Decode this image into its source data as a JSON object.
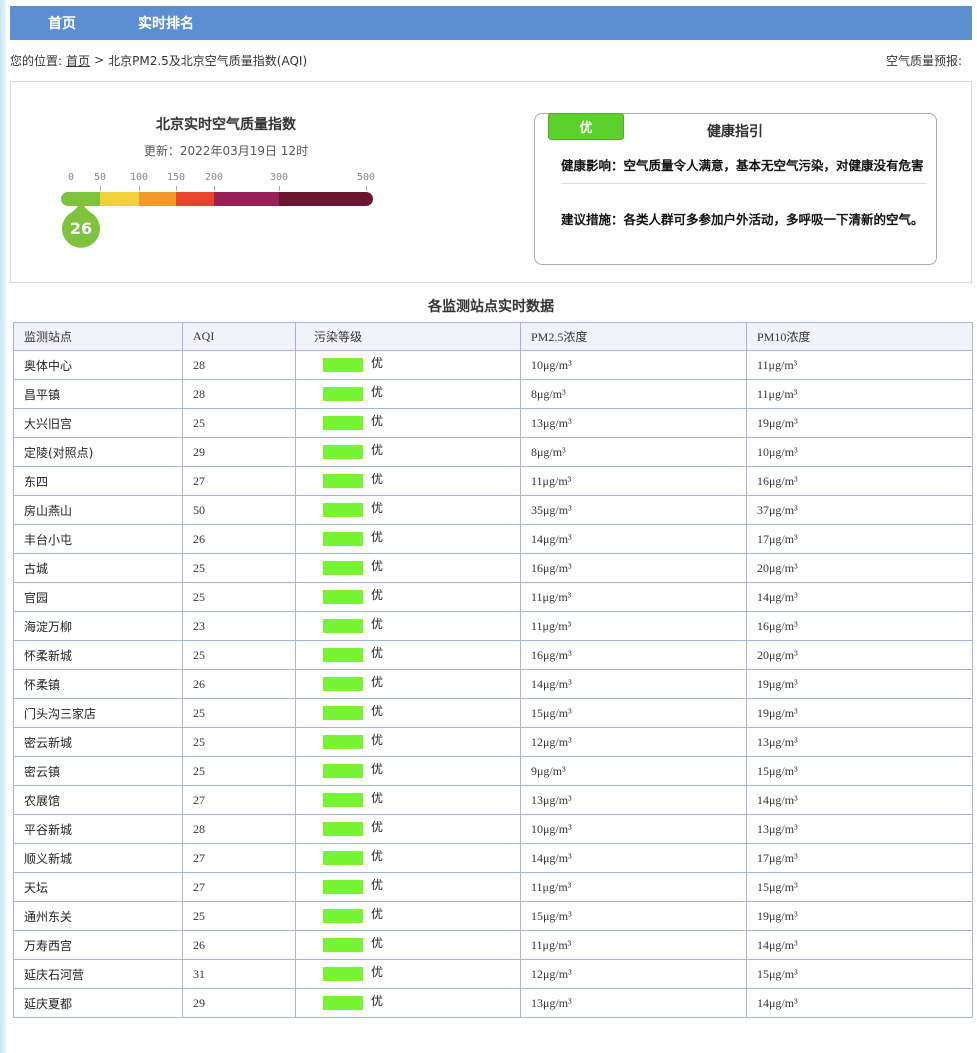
{
  "nav": {
    "home": "首页",
    "ranking": "实时排名"
  },
  "breadcrumb": {
    "prefix": "您的位置:",
    "home_link": "首页",
    "separator": ">",
    "current": "北京PM2.5及北京空气质量指数(AQI)",
    "forecast": "空气质量预报:"
  },
  "aqi": {
    "title": "北京实时空气质量指数",
    "update": "更新：2022年03月19日 12时",
    "value": "26",
    "scale_ticks": [
      "0",
      "50",
      "100",
      "150",
      "200",
      "300",
      "500"
    ],
    "scale_colors": [
      "#7dc33b",
      "#f2d23c",
      "#f09a2b",
      "#e8442b",
      "#962157",
      "#6b1630"
    ]
  },
  "health": {
    "level": "优",
    "title": "健康指引",
    "impact": "健康影响：空气质量令人满意，基本无空气污染，对健康没有危害",
    "advice": "建议措施：各类人群可多参加户外活动，多呼吸一下清新的空气。",
    "level_color": "#5bd12c"
  },
  "table": {
    "title": "各监测站点实时数据",
    "headers": [
      "监测站点",
      "AQI",
      "污染等级",
      "PM2.5浓度",
      "PM10浓度"
    ],
    "level_color": "#76f331",
    "rows": [
      {
        "station": "奥体中心",
        "aqi": "28",
        "level": "优",
        "pm25": "10μg/m³",
        "pm10": "11μg/m³"
      },
      {
        "station": "昌平镇",
        "aqi": "28",
        "level": "优",
        "pm25": "8μg/m³",
        "pm10": "11μg/m³"
      },
      {
        "station": "大兴旧宫",
        "aqi": "25",
        "level": "优",
        "pm25": "13μg/m³",
        "pm10": "19μg/m³"
      },
      {
        "station": "定陵(对照点)",
        "aqi": "29",
        "level": "优",
        "pm25": "8μg/m³",
        "pm10": "10μg/m³"
      },
      {
        "station": "东四",
        "aqi": "27",
        "level": "优",
        "pm25": "11μg/m³",
        "pm10": "16μg/m³"
      },
      {
        "station": "房山燕山",
        "aqi": "50",
        "level": "优",
        "pm25": "35μg/m³",
        "pm10": "37μg/m³"
      },
      {
        "station": "丰台小屯",
        "aqi": "26",
        "level": "优",
        "pm25": "14μg/m³",
        "pm10": "17μg/m³"
      },
      {
        "station": "古城",
        "aqi": "25",
        "level": "优",
        "pm25": "16μg/m³",
        "pm10": "20μg/m³"
      },
      {
        "station": "官园",
        "aqi": "25",
        "level": "优",
        "pm25": "11μg/m³",
        "pm10": "14μg/m³"
      },
      {
        "station": "海淀万柳",
        "aqi": "23",
        "level": "优",
        "pm25": "11μg/m³",
        "pm10": "16μg/m³"
      },
      {
        "station": "怀柔新城",
        "aqi": "25",
        "level": "优",
        "pm25": "16μg/m³",
        "pm10": "20μg/m³"
      },
      {
        "station": "怀柔镇",
        "aqi": "26",
        "level": "优",
        "pm25": "14μg/m³",
        "pm10": "19μg/m³"
      },
      {
        "station": "门头沟三家店",
        "aqi": "25",
        "level": "优",
        "pm25": "15μg/m³",
        "pm10": "19μg/m³"
      },
      {
        "station": "密云新城",
        "aqi": "25",
        "level": "优",
        "pm25": "12μg/m³",
        "pm10": "13μg/m³"
      },
      {
        "station": "密云镇",
        "aqi": "25",
        "level": "优",
        "pm25": "9μg/m³",
        "pm10": "15μg/m³"
      },
      {
        "station": "农展馆",
        "aqi": "27",
        "level": "优",
        "pm25": "13μg/m³",
        "pm10": "14μg/m³"
      },
      {
        "station": "平谷新城",
        "aqi": "28",
        "level": "优",
        "pm25": "10μg/m³",
        "pm10": "13μg/m³"
      },
      {
        "station": "顺义新城",
        "aqi": "27",
        "level": "优",
        "pm25": "14μg/m³",
        "pm10": "17μg/m³"
      },
      {
        "station": "天坛",
        "aqi": "27",
        "level": "优",
        "pm25": "11μg/m³",
        "pm10": "15μg/m³"
      },
      {
        "station": "通州东关",
        "aqi": "25",
        "level": "优",
        "pm25": "15μg/m³",
        "pm10": "19μg/m³"
      },
      {
        "station": "万寿西宫",
        "aqi": "26",
        "level": "优",
        "pm25": "11μg/m³",
        "pm10": "14μg/m³"
      },
      {
        "station": "延庆石河营",
        "aqi": "31",
        "level": "优",
        "pm25": "12μg/m³",
        "pm10": "15μg/m³"
      },
      {
        "station": "延庆夏都",
        "aqi": "29",
        "level": "优",
        "pm25": "13μg/m³",
        "pm10": "14μg/m³"
      }
    ]
  }
}
